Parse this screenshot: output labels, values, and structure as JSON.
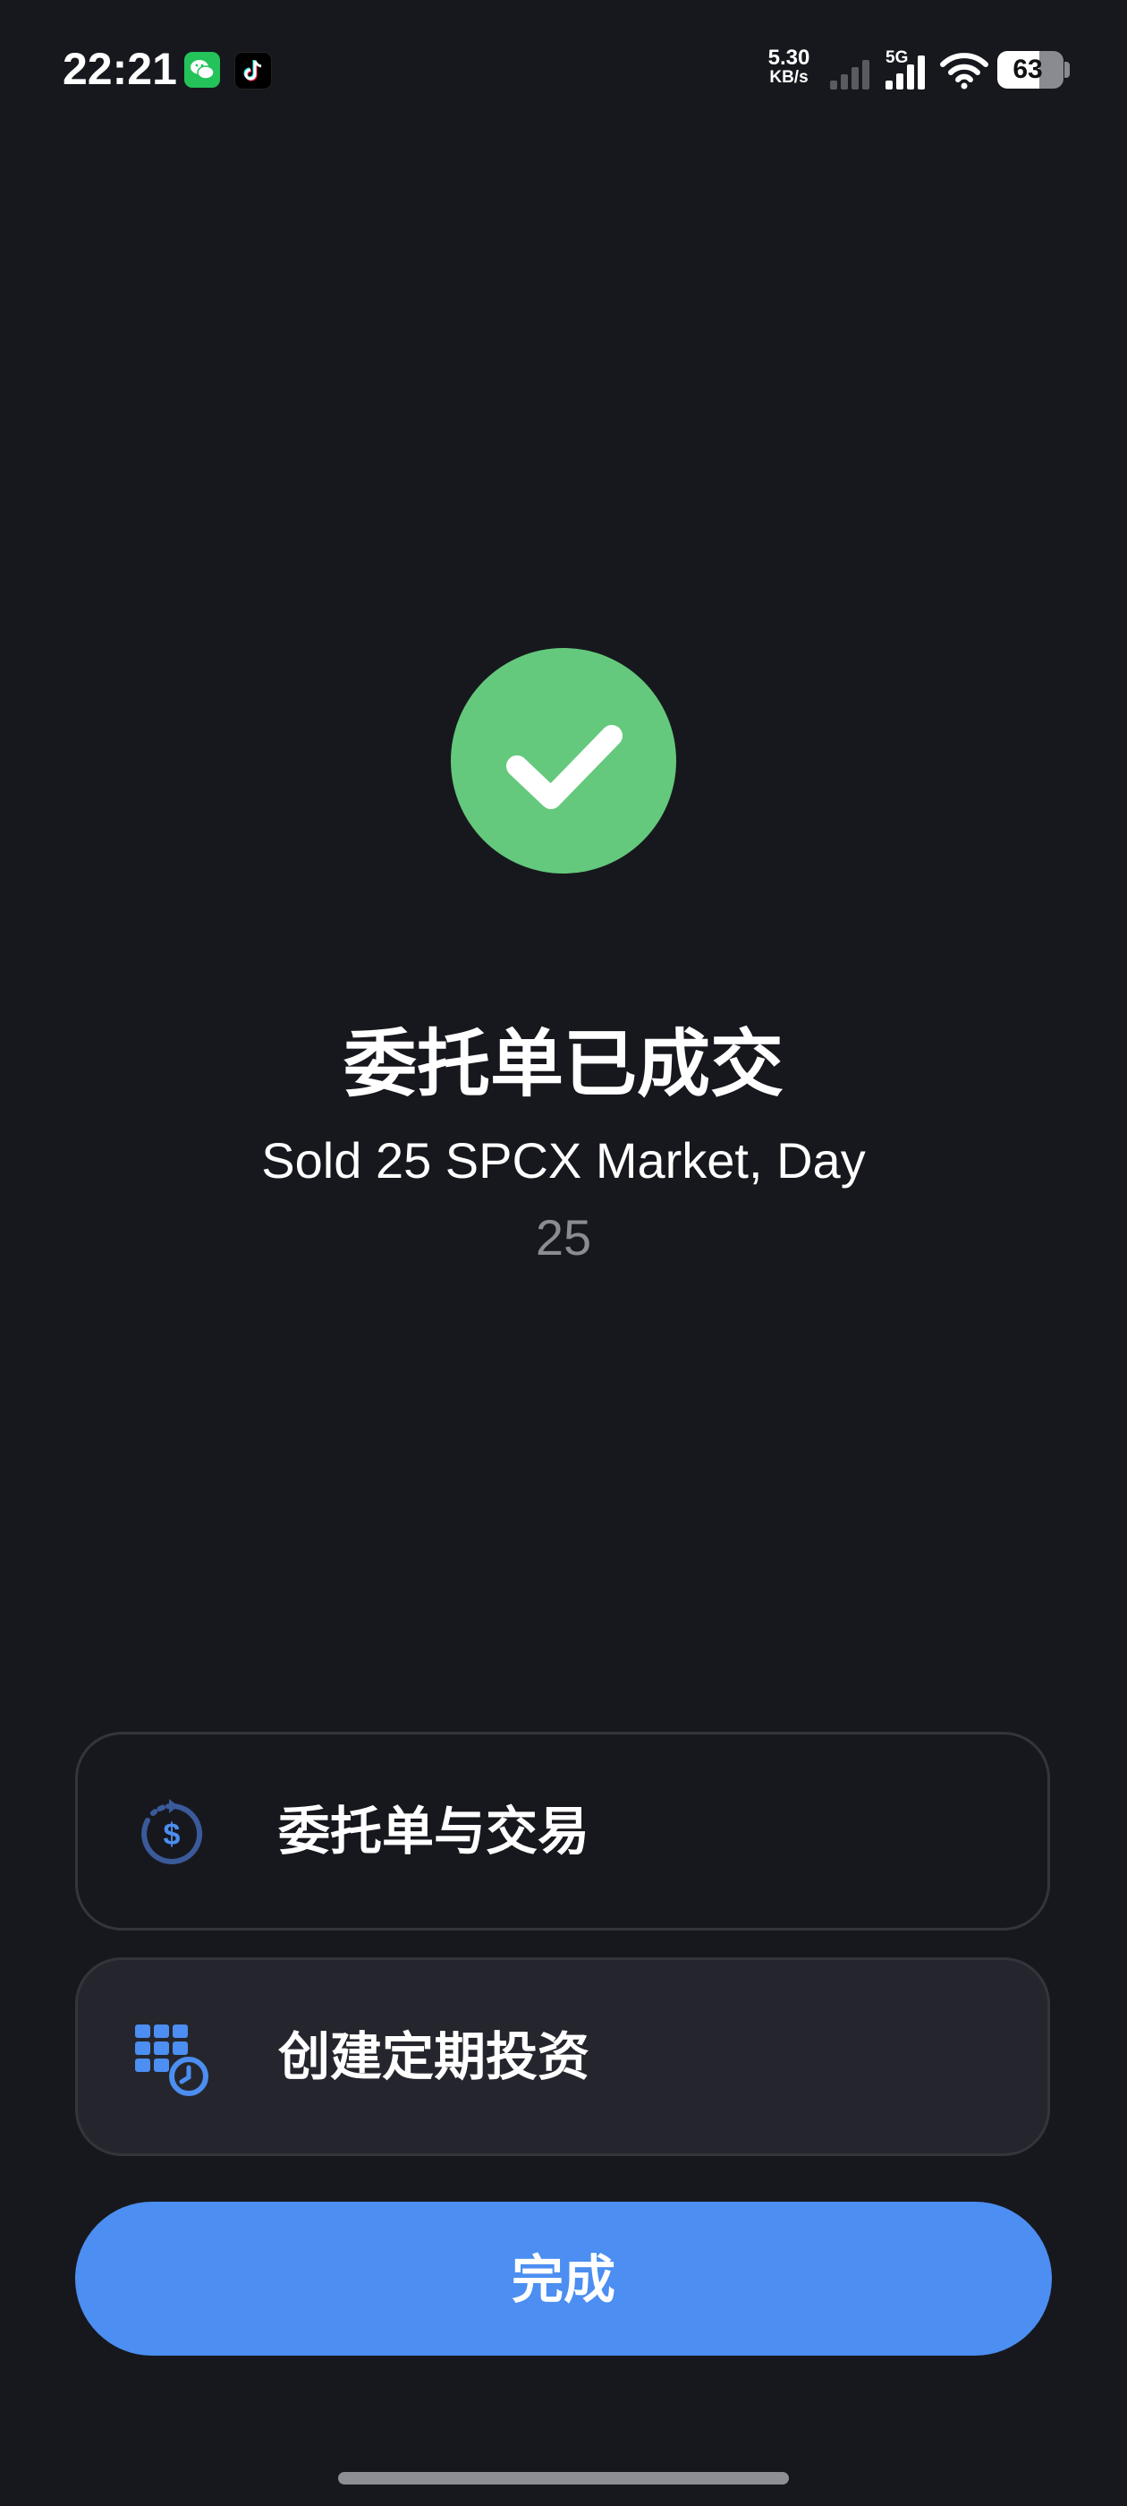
{
  "status_bar": {
    "time": "22:21",
    "net_speed_value": "5.30",
    "net_speed_unit": "KB/s",
    "network_tag": "5G",
    "battery_level": "63",
    "battery_fraction": 0.63,
    "icons": [
      "wechat-icon",
      "tiktok-icon",
      "signal-weak-icon",
      "signal-5g-icon",
      "wifi-icon",
      "battery-icon"
    ]
  },
  "success": {
    "icon": "check-icon",
    "title": "委托单已成交",
    "summary": "Sold 25 SPCX Market, Day",
    "quantity": "25"
  },
  "actions": {
    "orders_label": "委托单与交易",
    "orders_icon": "dollar-cycle-icon",
    "recurring_label": "创建定期投资",
    "recurring_icon": "calendar-clock-icon"
  },
  "done_label": "完成",
  "colors": {
    "background": "#17181e",
    "success_green": "#64c97c",
    "accent_blue": "#4c8ef1",
    "card_border": "#34353c",
    "muted_text": "#8b8c92"
  }
}
